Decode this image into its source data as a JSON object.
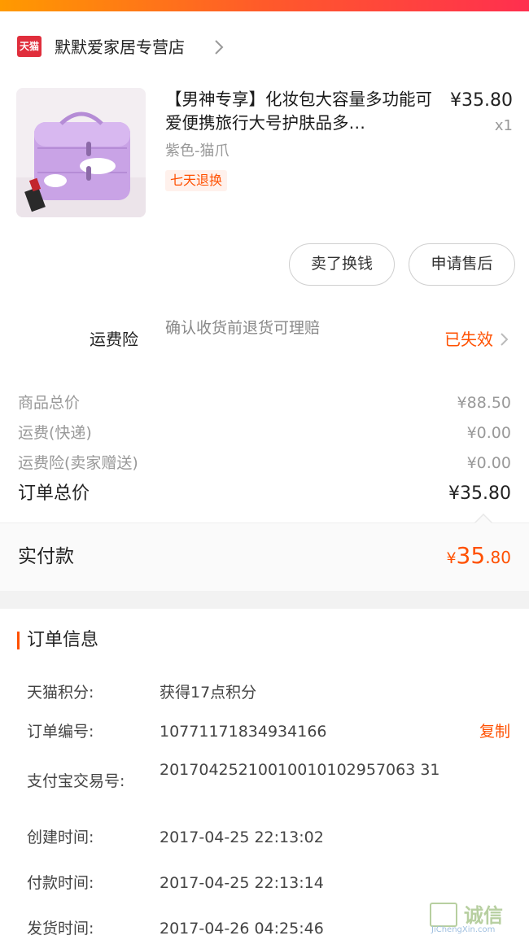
{
  "shop": {
    "logo_text": "天猫",
    "name": "默默爱家居专营店"
  },
  "product": {
    "title": "【男神专享】化妆包大容量多功能可爱便携旅行大号护肤品多…",
    "price": "¥35.80",
    "quantity": "x1",
    "sku": "紫色-猫爪",
    "tag": "七天退换",
    "image_colors": {
      "bag": "#c9a3e6",
      "background": "#f3eef2"
    }
  },
  "actions": {
    "sell_label": "卖了换钱",
    "aftersale_label": "申请售后"
  },
  "insurance": {
    "label": "运费险",
    "description": "确认收货前退货可理赔",
    "status": "已失效"
  },
  "fees": [
    {
      "label": "商品总价",
      "value": "¥88.50"
    },
    {
      "label": "运费(快递)",
      "value": "¥0.00"
    },
    {
      "label": "运费险(卖家赠送)",
      "value": "¥0.00"
    }
  ],
  "order_total": {
    "label": "订单总价",
    "value": "¥35.80"
  },
  "paid": {
    "label": "实付款",
    "currency": "¥",
    "integer": "35",
    "decimal": ".80"
  },
  "order_info": {
    "title": "订单信息",
    "copy_label": "复制",
    "rows": [
      {
        "label": "天猫积分:",
        "value": "获得17点积分"
      },
      {
        "label": "订单编号:",
        "value": "10771171834934166"
      },
      {
        "label": "支付宝交易号:",
        "value": "20170425210010010102957063 31"
      },
      {
        "label": "创建时间:",
        "value": "2017-04-25 22:13:02"
      },
      {
        "label": "付款时间:",
        "value": "2017-04-25 22:13:14"
      },
      {
        "label": "发货时间:",
        "value": "2017-04-26 04:25:46"
      }
    ]
  },
  "watermark": {
    "text": "诚信",
    "sub": "JiChengXin.com"
  },
  "colors": {
    "accent": "#ff5000",
    "tmall_red": "#e02e3c"
  }
}
